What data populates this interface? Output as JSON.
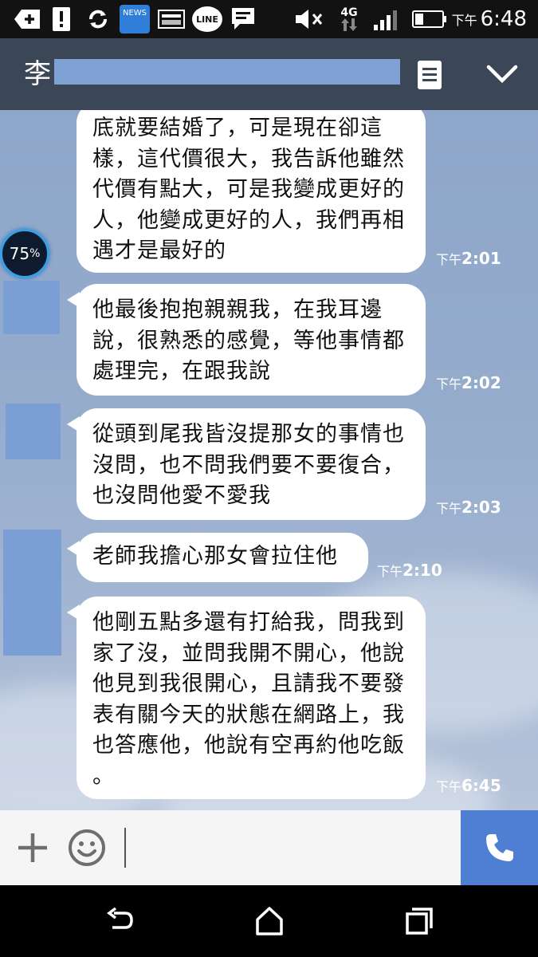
{
  "status_bar": {
    "icons": [
      "add-icon",
      "alert-icon",
      "sync-icon",
      "news-icon",
      "image-icon",
      "line-icon",
      "message-icon",
      "mute-icon",
      "network-4g-icon",
      "signal-icon",
      "battery-icon"
    ],
    "news_label": "NEWS",
    "line_label": "LINE",
    "network_label": "4G",
    "time_prefix": "下午",
    "time": "6:48"
  },
  "header": {
    "contact_name_visible": "李"
  },
  "overlay": {
    "progress_value": "75",
    "progress_unit": "%"
  },
  "messages": [
    {
      "text": "底就要結婚了，可是現在卻這樣，這代價很大，我告訴他雖然代價有點大，可是我變成更好的人，他變成更好的人，我們再相遇才是最好的",
      "time_prefix": "下午",
      "time": "2:01"
    },
    {
      "text": "他最後抱抱親親我，在我耳邊說，很熟悉的感覺，等他事情都處理完，在跟我說",
      "time_prefix": "下午",
      "time": "2:02"
    },
    {
      "text": "從頭到尾我皆沒提那女的事情也沒問，也不問我們要不要復合，也沒問他愛不愛我",
      "time_prefix": "下午",
      "time": "2:03"
    },
    {
      "text": "老師我擔心那女會拉住他",
      "time_prefix": "下午",
      "time": "2:10"
    },
    {
      "text": "他剛五點多還有打給我，問我到家了沒，並問我開不開心，他說他見到我很開心，且請我不要發表有關今天的狀態在網路上，我也答應他，他說有空再約他吃飯 。",
      "time_prefix": "下午",
      "time": "6:45"
    }
  ],
  "input": {
    "placeholder": ""
  },
  "colors": {
    "header_bg": "#3b4656",
    "call_button": "#4f7fd3",
    "bubble": "#ffffff",
    "redaction": "#7fa1d4"
  }
}
